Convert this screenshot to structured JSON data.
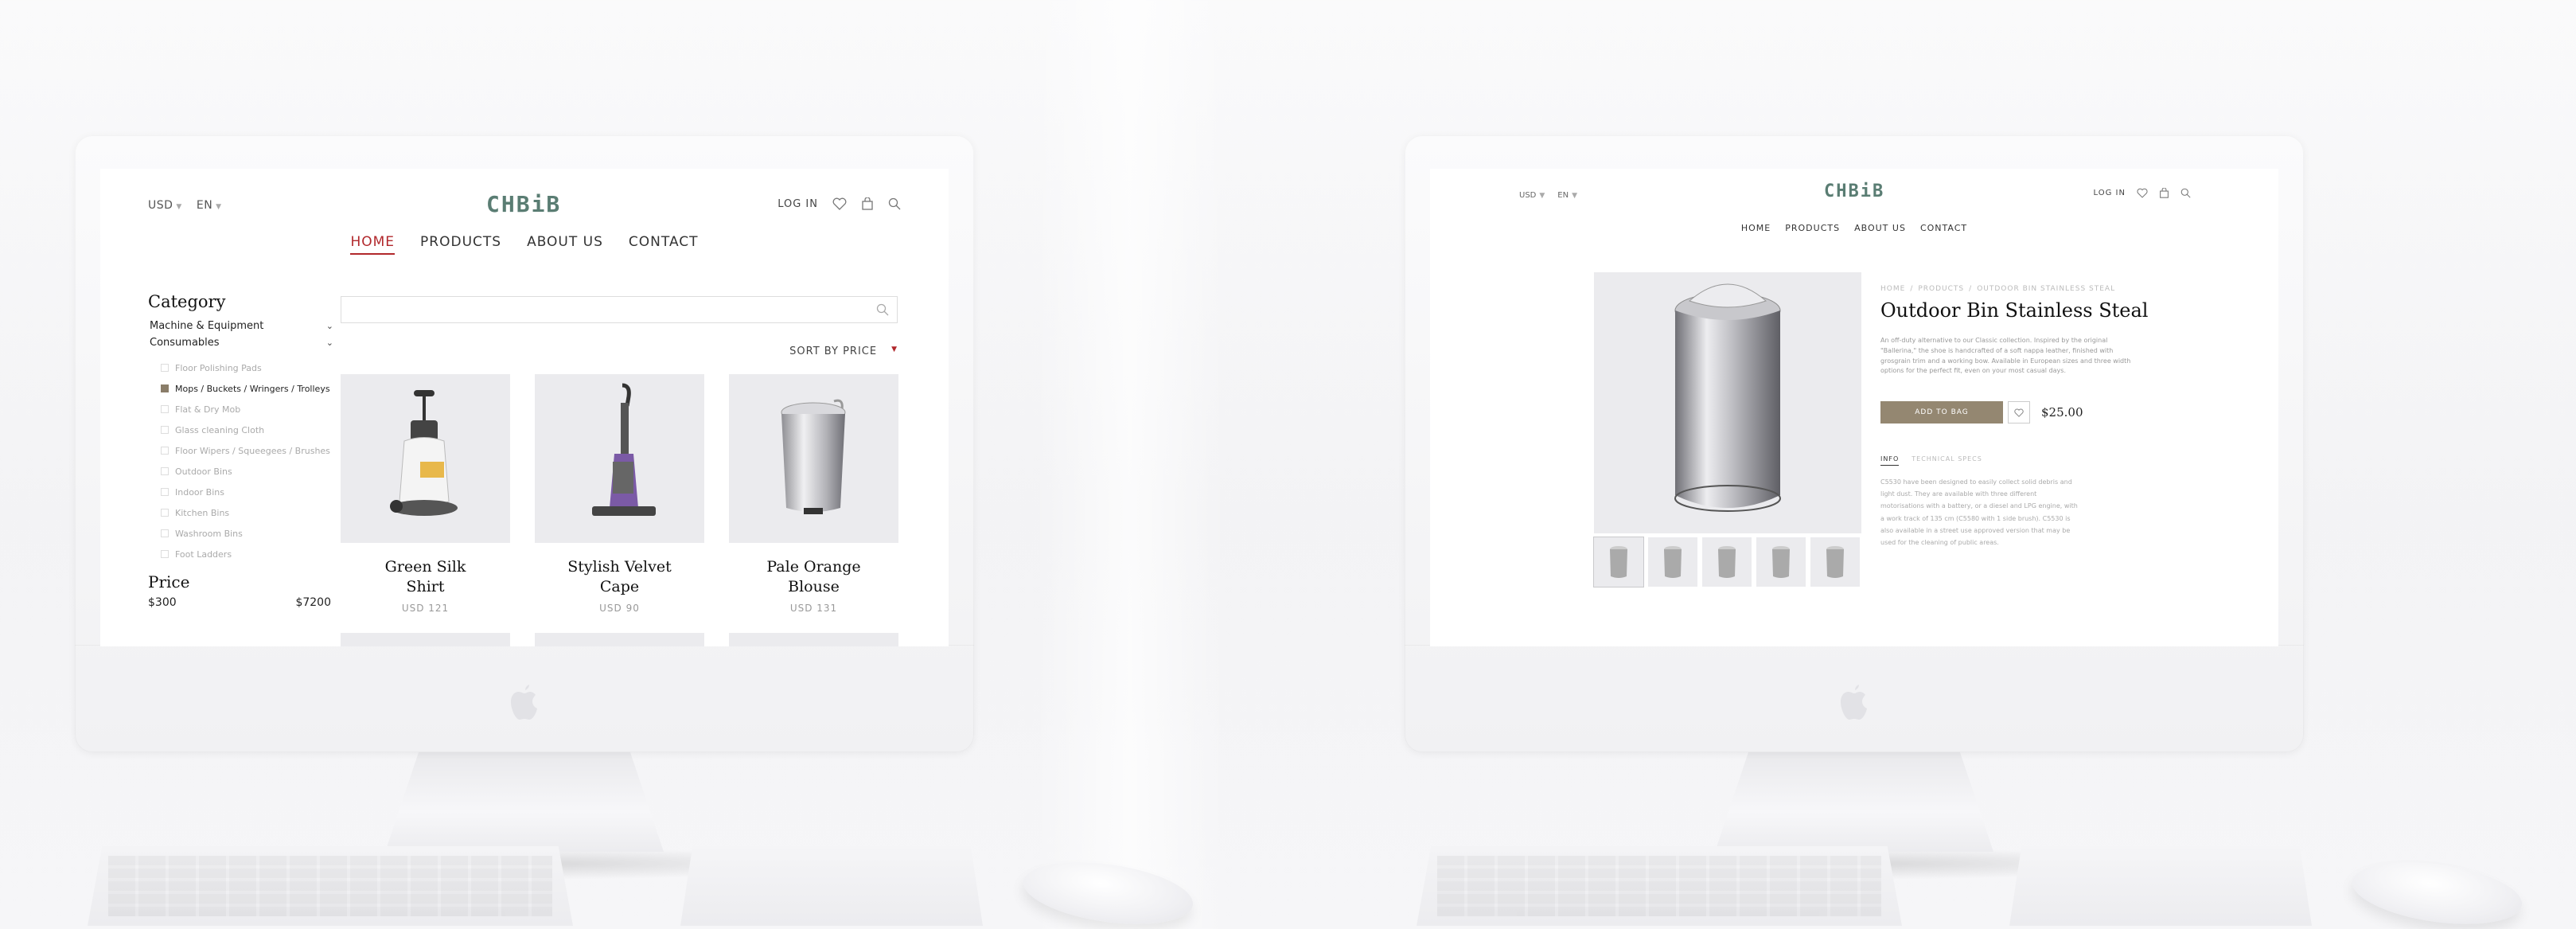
{
  "store": {
    "logo": "CHBiB",
    "currency": "USD",
    "language": "EN",
    "login": "LOG IN",
    "nav": [
      "HOME",
      "PRODUCTS",
      "ABOUT US",
      "CONTACT"
    ],
    "active_nav": "HOME"
  },
  "listing": {
    "category_title": "Category",
    "categories": [
      {
        "label": "Machine & Equipment",
        "expanded": false
      },
      {
        "label": "Consumables",
        "expanded": true
      }
    ],
    "subcategories": [
      {
        "label": "Floor Polishing Pads",
        "checked": false
      },
      {
        "label": "Mops / Buckets / Wringers / Trolleys",
        "checked": true
      },
      {
        "label": "Flat & Dry Mob",
        "checked": false
      },
      {
        "label": "Glass cleaning Cloth",
        "checked": false
      },
      {
        "label": "Floor Wipers / Squeegees / Brushes",
        "checked": false
      },
      {
        "label": "Outdoor Bins",
        "checked": false
      },
      {
        "label": "Indoor Bins",
        "checked": false
      },
      {
        "label": "Kitchen Bins",
        "checked": false
      },
      {
        "label": "Washroom Bins",
        "checked": false
      },
      {
        "label": "Foot Ladders",
        "checked": false
      }
    ],
    "price_title": "Price",
    "price_min": "$300",
    "price_max": "$7200",
    "search_placeholder": "",
    "sort_label": "SORT BY PRICE",
    "products": [
      {
        "name": "Green Silk Shirt",
        "price": "USD 121",
        "icon": "floor-scrubber-image"
      },
      {
        "name": "Stylish Velvet Cape",
        "price": "USD 90",
        "icon": "upright-vacuum-image"
      },
      {
        "name": "Pale Orange Blouse",
        "price": "USD 131",
        "icon": "pedal-bin-image"
      }
    ]
  },
  "product": {
    "breadcrumb": [
      "HOME",
      "/",
      "PRODUCTS",
      "/",
      "OUTDOOR BIN STAINLESS STEAL"
    ],
    "title": "Outdoor Bin Stainless Steal",
    "description": "An off-duty alternative to our Classic collection. Inspired by the original \"Ballerina,\" the shoe is handcrafted of a soft nappa leather, finished with grosgrain trim and a working bow. Available in European sizes and three width options for the perfect fit, even on your most casual days.",
    "add_to_bag": "ADD TO BAG",
    "price": "$25.00",
    "tabs": [
      "INFO",
      "TECHNICAL SPECS"
    ],
    "active_tab": "INFO",
    "info_text": "C5530 have been designed to easily collect solid debris and light dust. They are available with three different motorisations with a battery, or a diesel and LPG engine, with a work track of 135 cm (C5580 with 1 side brush). C5530 is also available in a street use approved version that may be used for the cleaning of public areas.",
    "thumbnail_count": 5
  },
  "colors": {
    "accent_red": "#b1282c",
    "logo_green": "#5a7d73",
    "button_taupe": "#948771"
  }
}
